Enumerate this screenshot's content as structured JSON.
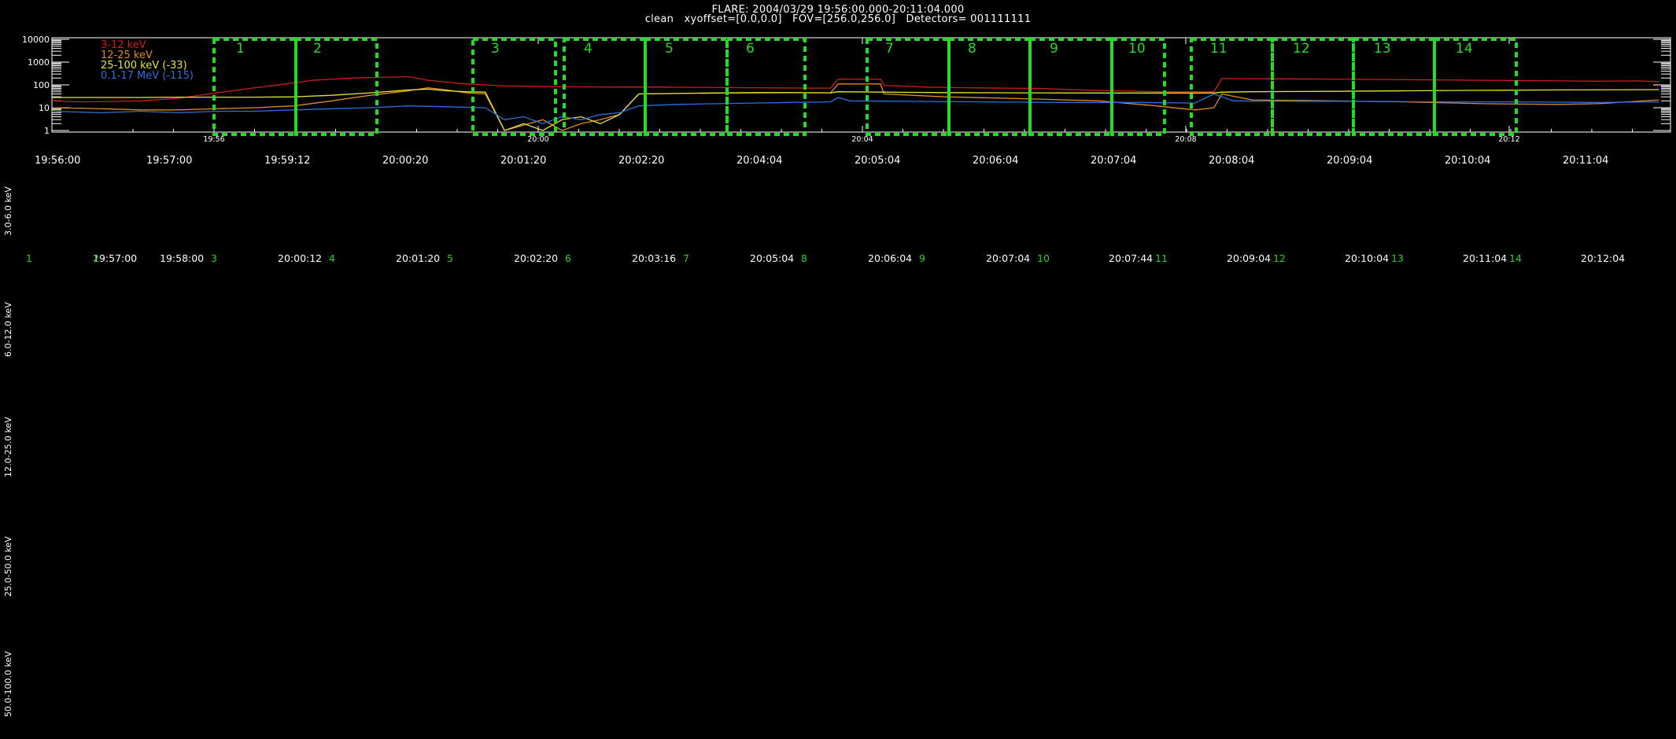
{
  "header": {
    "line1": "FLARE: 2004/03/29 19:56:00.000-20:11:04.000",
    "line2": "clean   xyoffset=[0.0,0.0]   FOV=[256.0,256.0]   Detectors= 001111111"
  },
  "colors": {
    "background": "#000000",
    "box": "#22dd22",
    "axis": "#ffffff",
    "interval_number": "#22d422"
  },
  "chart_data": {
    "type": "line",
    "title": "FLARE: 2004/03/29 19:56:00.000-20:11:04.000",
    "scale": "log",
    "ylim": [
      1,
      10000
    ],
    "xlim_minutes": [
      -0.3,
      18.3
    ],
    "y_tick_labels": [
      "10000",
      "1000",
      "100",
      "10",
      "1"
    ],
    "y_tick_values": [
      10000,
      1000,
      100,
      10,
      1
    ],
    "x_tick_labels": [
      "19:56",
      "20:00",
      "20:04",
      "20:08",
      "20:12"
    ],
    "x_tick_minutes": [
      0,
      4,
      8,
      12,
      16
    ],
    "legend_position": "top-left",
    "series": [
      {
        "name": "3-12 keV",
        "color": "#d01c1c",
        "points": [
          [
            -0.3,
            20
          ],
          [
            0.5,
            18
          ],
          [
            1.5,
            19
          ],
          [
            2.0,
            20
          ],
          [
            3.0,
            26
          ],
          [
            4.0,
            45
          ],
          [
            5.0,
            75
          ],
          [
            5.8,
            110
          ],
          [
            6.5,
            160
          ],
          [
            7.5,
            200
          ],
          [
            8.5,
            220
          ],
          [
            9.0,
            230
          ],
          [
            9.5,
            160
          ],
          [
            10.5,
            110
          ],
          [
            11.5,
            90
          ],
          [
            12.5,
            85
          ],
          [
            13.5,
            82
          ],
          [
            14.5,
            80
          ],
          [
            15.5,
            80
          ],
          [
            16.5,
            78
          ],
          [
            17.5,
            76
          ],
          [
            18.5,
            74
          ],
          [
            19.5,
            72
          ],
          [
            20.0,
            72
          ],
          [
            20.2,
            180
          ],
          [
            21.3,
            180
          ],
          [
            21.4,
            95
          ],
          [
            22.5,
            80
          ],
          [
            23.5,
            75
          ],
          [
            24.5,
            72
          ],
          [
            25.5,
            70
          ],
          [
            26.5,
            60
          ],
          [
            27.5,
            55
          ],
          [
            28.5,
            50
          ],
          [
            29.5,
            50
          ],
          [
            30.0,
            50
          ],
          [
            30.2,
            190
          ],
          [
            31.5,
            185
          ],
          [
            33.0,
            180
          ],
          [
            35.0,
            170
          ],
          [
            37.0,
            160
          ],
          [
            39.0,
            150
          ],
          [
            40.0,
            145
          ],
          [
            41.0,
            150
          ],
          [
            41.6,
            140
          ]
        ]
      },
      {
        "name": "12-25 keV",
        "color": "#e08a1e",
        "points": [
          [
            -0.3,
            10
          ],
          [
            1.0,
            9
          ],
          [
            2.0,
            8
          ],
          [
            3.0,
            8
          ],
          [
            4.0,
            9
          ],
          [
            5.0,
            10
          ],
          [
            6.0,
            12
          ],
          [
            7.0,
            20
          ],
          [
            8.0,
            35
          ],
          [
            9.0,
            55
          ],
          [
            9.5,
            75
          ],
          [
            10.0,
            60
          ],
          [
            10.5,
            45
          ],
          [
            11.0,
            40
          ],
          [
            11.5,
            1
          ],
          [
            12.5,
            3
          ],
          [
            13.0,
            1
          ],
          [
            13.5,
            2
          ],
          [
            14.0,
            3
          ],
          [
            14.5,
            5
          ],
          [
            15.0,
            40
          ],
          [
            16.0,
            42
          ],
          [
            17.0,
            44
          ],
          [
            18.0,
            45
          ],
          [
            19.0,
            46
          ],
          [
            20.0,
            45
          ],
          [
            20.2,
            110
          ],
          [
            21.3,
            110
          ],
          [
            21.4,
            40
          ],
          [
            23.0,
            30
          ],
          [
            25.0,
            25
          ],
          [
            27.0,
            20
          ],
          [
            28.5,
            12
          ],
          [
            29.5,
            8
          ],
          [
            30.0,
            10
          ],
          [
            30.2,
            40
          ],
          [
            31.0,
            22
          ],
          [
            33.0,
            20
          ],
          [
            35.0,
            18
          ],
          [
            37.0,
            15
          ],
          [
            39.0,
            14
          ],
          [
            40.0,
            15
          ],
          [
            41.6,
            22
          ]
        ]
      },
      {
        "name": "25-100 keV (-33)",
        "color": "#e5e535",
        "points": [
          [
            -0.3,
            28
          ],
          [
            1.0,
            28
          ],
          [
            2.0,
            28
          ],
          [
            3.0,
            29
          ],
          [
            4.0,
            29
          ],
          [
            5.0,
            29
          ],
          [
            6.0,
            30
          ],
          [
            7.0,
            35
          ],
          [
            8.0,
            45
          ],
          [
            9.0,
            60
          ],
          [
            9.5,
            65
          ],
          [
            10.0,
            55
          ],
          [
            10.5,
            50
          ],
          [
            11.0,
            48
          ],
          [
            11.5,
            1
          ],
          [
            12.0,
            2
          ],
          [
            12.5,
            1
          ],
          [
            13.0,
            3
          ],
          [
            13.5,
            4
          ],
          [
            14.0,
            2
          ],
          [
            14.5,
            5
          ],
          [
            15.0,
            40
          ],
          [
            16.0,
            42
          ],
          [
            17.0,
            44
          ],
          [
            18.0,
            46
          ],
          [
            19.0,
            46
          ],
          [
            20.0,
            45
          ],
          [
            20.2,
            50
          ],
          [
            21.4,
            48
          ],
          [
            23.0,
            46
          ],
          [
            25.0,
            45
          ],
          [
            27.0,
            44
          ],
          [
            29.0,
            44
          ],
          [
            30.0,
            44
          ],
          [
            30.2,
            48
          ],
          [
            31.0,
            50
          ],
          [
            33.0,
            52
          ],
          [
            35.0,
            55
          ],
          [
            37.0,
            58
          ],
          [
            39.0,
            60
          ],
          [
            41.6,
            62
          ]
        ]
      },
      {
        "name": "0.1-17 MeV (-115)",
        "color": "#2a6fe0",
        "points": [
          [
            -0.3,
            7
          ],
          [
            1.0,
            6
          ],
          [
            2.0,
            7
          ],
          [
            3.0,
            6
          ],
          [
            4.0,
            7
          ],
          [
            5.0,
            7
          ],
          [
            6.0,
            8
          ],
          [
            7.0,
            9
          ],
          [
            8.0,
            10
          ],
          [
            9.0,
            12
          ],
          [
            10.0,
            11
          ],
          [
            11.0,
            10
          ],
          [
            11.5,
            3
          ],
          [
            12.0,
            4
          ],
          [
            12.5,
            2
          ],
          [
            13.0,
            4
          ],
          [
            13.5,
            3
          ],
          [
            14.0,
            5
          ],
          [
            14.5,
            6
          ],
          [
            15.0,
            12
          ],
          [
            16.0,
            14
          ],
          [
            17.0,
            15
          ],
          [
            18.0,
            16
          ],
          [
            19.0,
            17
          ],
          [
            20.0,
            18
          ],
          [
            20.2,
            28
          ],
          [
            20.5,
            20
          ],
          [
            22.0,
            19
          ],
          [
            24.0,
            18
          ],
          [
            26.0,
            17
          ],
          [
            28.0,
            17
          ],
          [
            29.5,
            16
          ],
          [
            30.0,
            40
          ],
          [
            30.5,
            20
          ],
          [
            32.0,
            19
          ],
          [
            34.0,
            19
          ],
          [
            36.0,
            18
          ],
          [
            38.0,
            18
          ],
          [
            40.0,
            17
          ],
          [
            41.6,
            18
          ]
        ]
      }
    ]
  },
  "time_labels": [
    "19:56:00",
    "19:57:00",
    "19:59:12",
    "20:00:20",
    "20:01:20",
    "20:02:20",
    "20:04:04",
    "20:05:04",
    "20:06:04",
    "20:07:04",
    "20:08:04",
    "20:09:04",
    "20:10:04",
    "20:11:04"
  ],
  "intervals": [
    {
      "num": "1",
      "time": "19:57:00"
    },
    {
      "num": "2",
      "time": "19:58:00"
    },
    {
      "num": "3",
      "time": "20:00:12"
    },
    {
      "num": "4",
      "time": "20:01:20"
    },
    {
      "num": "5",
      "time": "20:02:20"
    },
    {
      "num": "6",
      "time": "20:03:16"
    },
    {
      "num": "7",
      "time": "20:05:04"
    },
    {
      "num": "8",
      "time": "20:06:04"
    },
    {
      "num": "9",
      "time": "20:07:04"
    },
    {
      "num": "10",
      "time": "20:07:44"
    },
    {
      "num": "11",
      "time": "20:09:04"
    },
    {
      "num": "12",
      "time": "20:10:04"
    },
    {
      "num": "13",
      "time": "20:11:04"
    },
    {
      "num": "14",
      "time": "20:12:04"
    }
  ],
  "energy_bands": [
    "3.0-6.0 keV",
    "6.0-12.0 keV",
    "12.0-25.0 keV",
    "25.0-50.0 keV",
    "50.0-100.0 keV"
  ]
}
